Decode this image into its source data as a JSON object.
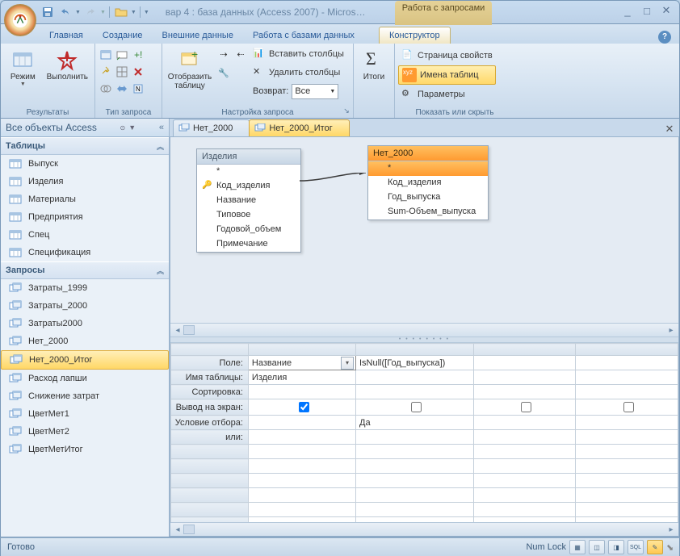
{
  "window": {
    "title": "вар 4 : база данных (Access 2007) - Micros…",
    "context_header": "Работа с запросами"
  },
  "tabs": [
    "Главная",
    "Создание",
    "Внешние данные",
    "Работа с базами данных"
  ],
  "context_tab": "Конструктор",
  "ribbon": {
    "g1": {
      "label": "Результаты",
      "mode": "Режим",
      "run": "Выполнить"
    },
    "g2": {
      "label": "Тип запроса"
    },
    "g3": {
      "label": "Настройка запроса",
      "show": "Отобразить\nтаблицу",
      "ins": "Вставить столбцы",
      "del": "Удалить столбцы",
      "ret": "Возврат:",
      "ret_val": "Все"
    },
    "g4": {
      "label": "",
      "totals": "Итоги"
    },
    "g5": {
      "label": "Показать или скрыть",
      "props": "Страница свойств",
      "names": "Имена таблиц",
      "params": "Параметры"
    }
  },
  "nav": {
    "title": "Все объекты Access",
    "groups": [
      {
        "label": "Таблицы",
        "items": [
          "Выпуск",
          "Изделия",
          "Материалы",
          "Предприятия",
          "Спец",
          "Спецификация"
        ]
      },
      {
        "label": "Запросы",
        "items": [
          "Затраты_1999",
          "Затраты_2000",
          "Затраты2000",
          "Нет_2000",
          "Нет_2000_Итог",
          "Расход лапши",
          "Снижение затрат",
          "ЦветМет1",
          "ЦветМет2",
          "ЦветМетИтог"
        ]
      }
    ],
    "selected": "Нет_2000_Итог"
  },
  "doctabs": [
    {
      "label": "Нет_2000",
      "active": false
    },
    {
      "label": "Нет_2000_Итог",
      "active": true
    }
  ],
  "tables": {
    "t1": {
      "title": "Изделия",
      "fields": [
        "*",
        "Код_изделия",
        "Название",
        "Типовое",
        "Годовой_объем",
        "Примечание"
      ],
      "key_idx": 1
    },
    "t2": {
      "title": "Нет_2000",
      "fields": [
        "*",
        "Код_изделия",
        "Год_выпуска",
        "Sum-Объем_выпуска"
      ]
    }
  },
  "grid": {
    "rows": [
      "Поле:",
      "Имя таблицы:",
      "Сортировка:",
      "Вывод на экран:",
      "Условие отбора:",
      "или:"
    ],
    "cols": [
      {
        "field": "Название",
        "table": "Изделия",
        "sort": "",
        "show": true,
        "crit": "",
        "or": ""
      },
      {
        "field": "IsNull([Год_выпуска])",
        "table": "",
        "sort": "",
        "show": false,
        "crit": "Да",
        "or": ""
      },
      {
        "field": "",
        "table": "",
        "sort": "",
        "show": false,
        "crit": "",
        "or": ""
      },
      {
        "field": "",
        "table": "",
        "sort": "",
        "show": false,
        "crit": "",
        "or": ""
      }
    ]
  },
  "status": {
    "left": "Готово",
    "right": "Num Lock"
  }
}
